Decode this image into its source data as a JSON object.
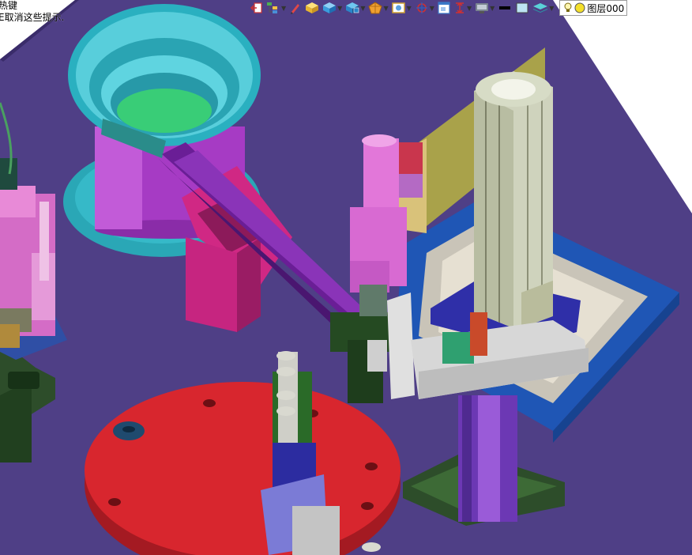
{
  "hint": {
    "line1": "热键",
    "line2": "E取消这些提示."
  },
  "toolbar": {
    "items": [
      {
        "icon": "back-icon",
        "dropdown": false
      },
      {
        "icon": "tree-icon",
        "dropdown": true
      },
      {
        "icon": "pencil-icon",
        "dropdown": false
      },
      {
        "icon": "yellow-cube-icon",
        "dropdown": false
      },
      {
        "icon": "blue-cube-icon",
        "dropdown": true
      },
      {
        "icon": "view-cube-icon",
        "dropdown": true
      },
      {
        "icon": "render-polygon-icon",
        "dropdown": true
      },
      {
        "icon": "picture-icon",
        "dropdown": true
      },
      {
        "icon": "target-icon",
        "dropdown": true
      },
      {
        "icon": "window-icon",
        "dropdown": false
      },
      {
        "icon": "height-icon",
        "dropdown": true
      },
      {
        "icon": "display-icon",
        "dropdown": true
      },
      {
        "icon": "black-line-icon",
        "dropdown": false
      },
      {
        "icon": "color-swatch-icon",
        "dropdown": false
      },
      {
        "icon": "layers-icon",
        "dropdown": true
      }
    ],
    "layer_label": "图层000"
  },
  "colors": {
    "floor": "#4f3f86",
    "bowl": "#2fb8c8",
    "magenta": "#c93aa8",
    "red_disc": "#d8262e",
    "green": "#2d4d2a",
    "blue_frame": "#1f56b5",
    "aluminum": "#cdd1b8"
  }
}
